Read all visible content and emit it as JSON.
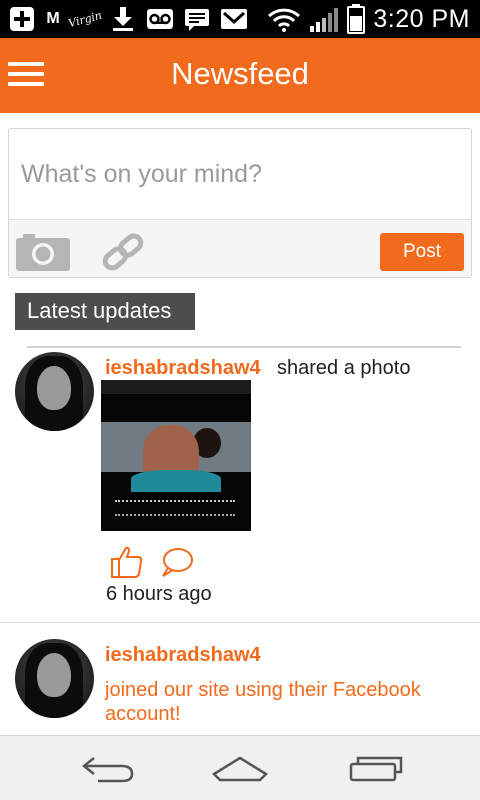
{
  "status_bar": {
    "time": "3:20 PM",
    "icons": [
      "add-icon",
      "gmail-m-icon",
      "virgin-icon",
      "download-icon",
      "voicemail-icon",
      "message-icon",
      "email-icon",
      "wifi-icon",
      "signal-icon",
      "battery-icon"
    ],
    "left_text": {
      "m": "M",
      "virgin": "Virgin"
    }
  },
  "header": {
    "title": "Newsfeed"
  },
  "composer": {
    "placeholder": "What's on your mind?",
    "value": "",
    "post_label": "Post"
  },
  "section": {
    "label": "Latest updates"
  },
  "feed": [
    {
      "username": "ieshabradshaw4",
      "action": "shared a photo",
      "time_ago": "6 hours ago",
      "has_photo": true
    },
    {
      "username": "ieshabradshaw4",
      "action": "joined our site using their Facebook account!"
    }
  ],
  "colors": {
    "accent": "#f26a1b",
    "label_bg": "#4d4d4d"
  }
}
